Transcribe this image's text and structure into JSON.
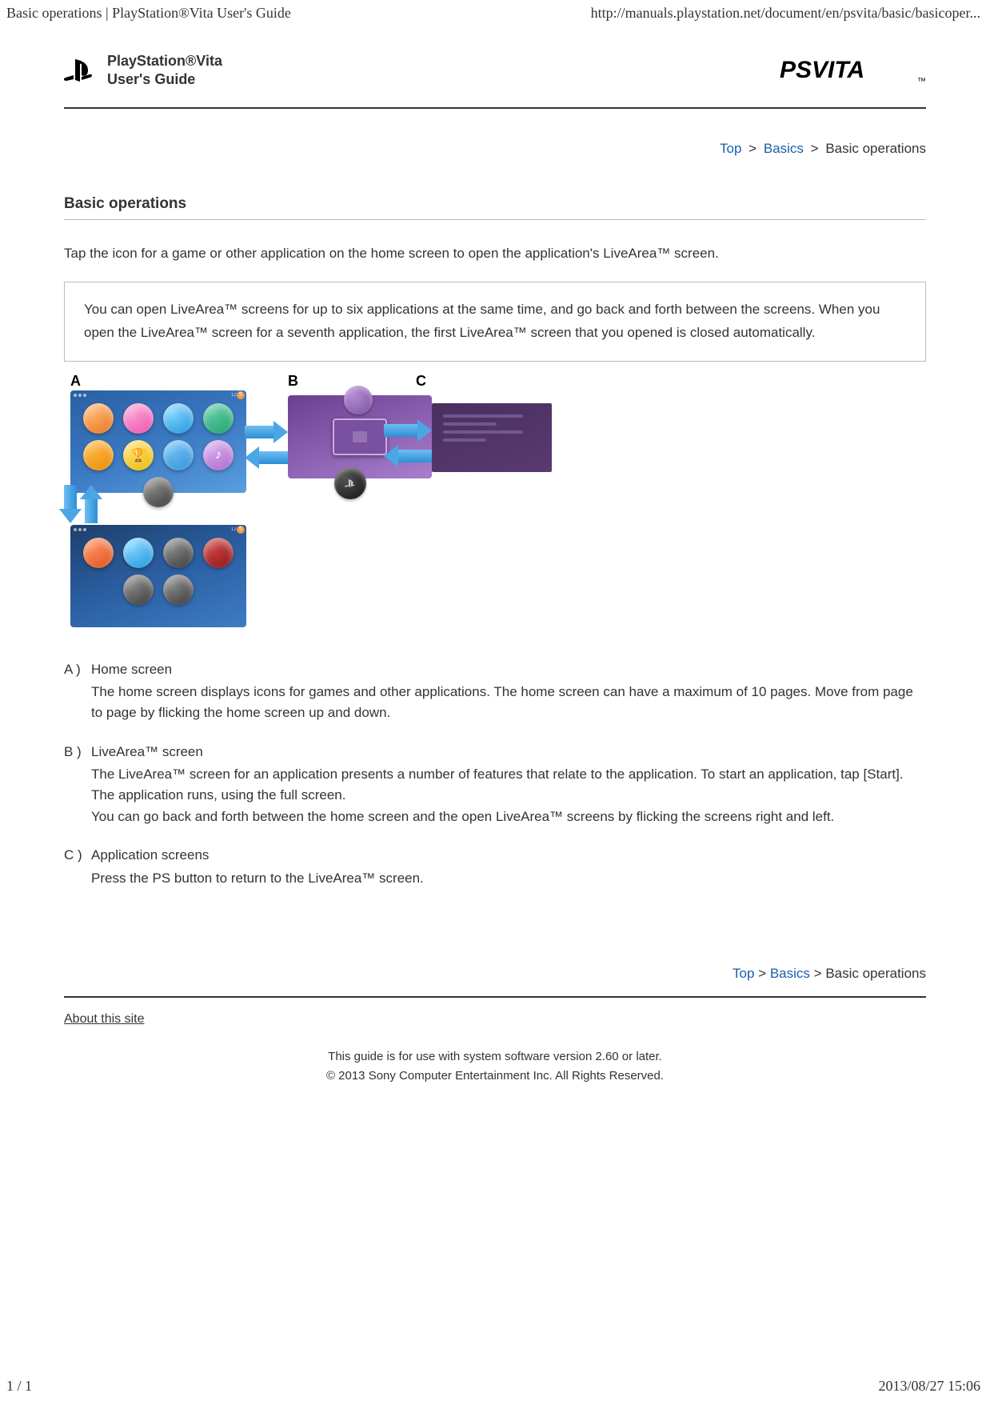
{
  "browser": {
    "page_title": "Basic operations | PlayStation®Vita User's Guide",
    "url": "http://manuals.playstation.net/document/en/psvita/basic/basicoper..."
  },
  "header": {
    "guide_title_line1": "PlayStation®Vita",
    "guide_title_line2": "User's Guide",
    "logo_text": "PSVITA",
    "logo_tm": "™"
  },
  "breadcrumb": {
    "top": "Top",
    "basics": "Basics",
    "sep": ">",
    "current": "Basic operations"
  },
  "content": {
    "title": "Basic operations",
    "intro": "Tap the icon for a game or other application on the home screen to open the application's LiveArea™ screen.",
    "note": "You can open LiveArea™ screens for up to six applications at the same time, and go back and forth between the screens. When you open the LiveArea™ screen for a seventh application, the first LiveArea™ screen that you opened is closed automatically.",
    "diagram_labels": {
      "a": "A",
      "b": "B",
      "c": "C"
    },
    "definitions": [
      {
        "marker": "A )",
        "title": "Home screen",
        "body": "The home screen displays icons for games and other applications. The home screen can have a maximum of 10 pages. Move from page to page by flicking the home screen up and down."
      },
      {
        "marker": "B )",
        "title": "LiveArea™ screen",
        "body": "The LiveArea™ screen for an application presents a number of features that relate to the application. To start an application, tap [Start]. The application runs, using the full screen.\nYou can go back and forth between the home screen and the open LiveArea™ screens by flicking the screens right and left."
      },
      {
        "marker": "C )",
        "title": "Application screens",
        "body": "Press the PS button to return to the LiveArea™ screen."
      }
    ]
  },
  "footer": {
    "about": "About this site",
    "note_line1": "This guide is for use with system software version 2.60 or later.",
    "note_line2": "© 2013 Sony Computer Entertainment Inc. All Rights Reserved."
  },
  "page_footer": {
    "page_num": "1 / 1",
    "timestamp": "2013/08/27 15:06"
  }
}
